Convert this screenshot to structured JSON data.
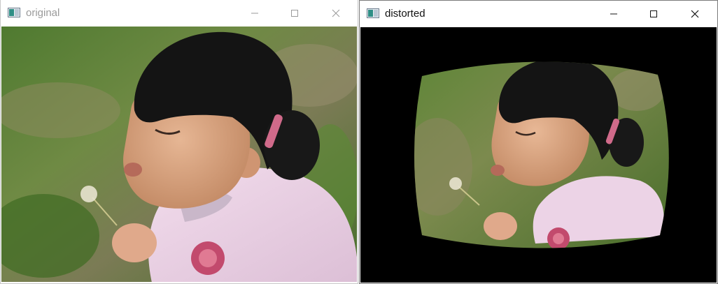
{
  "windows": {
    "original": {
      "title": "original",
      "icon": "image-window-icon",
      "controls": [
        "minimize-icon",
        "maximize-icon",
        "close-icon"
      ]
    },
    "distorted": {
      "title": "distorted",
      "icon": "image-window-icon",
      "controls": [
        "minimize-icon",
        "maximize-icon",
        "close-icon"
      ]
    }
  },
  "colors": {
    "distorted_background": "#000000",
    "grass_green": "#5f8f35",
    "hair_black": "#141414",
    "skin": "#d7a07c",
    "shirt_pink": "#ecd3e6",
    "flower_red": "#c24a6d"
  }
}
